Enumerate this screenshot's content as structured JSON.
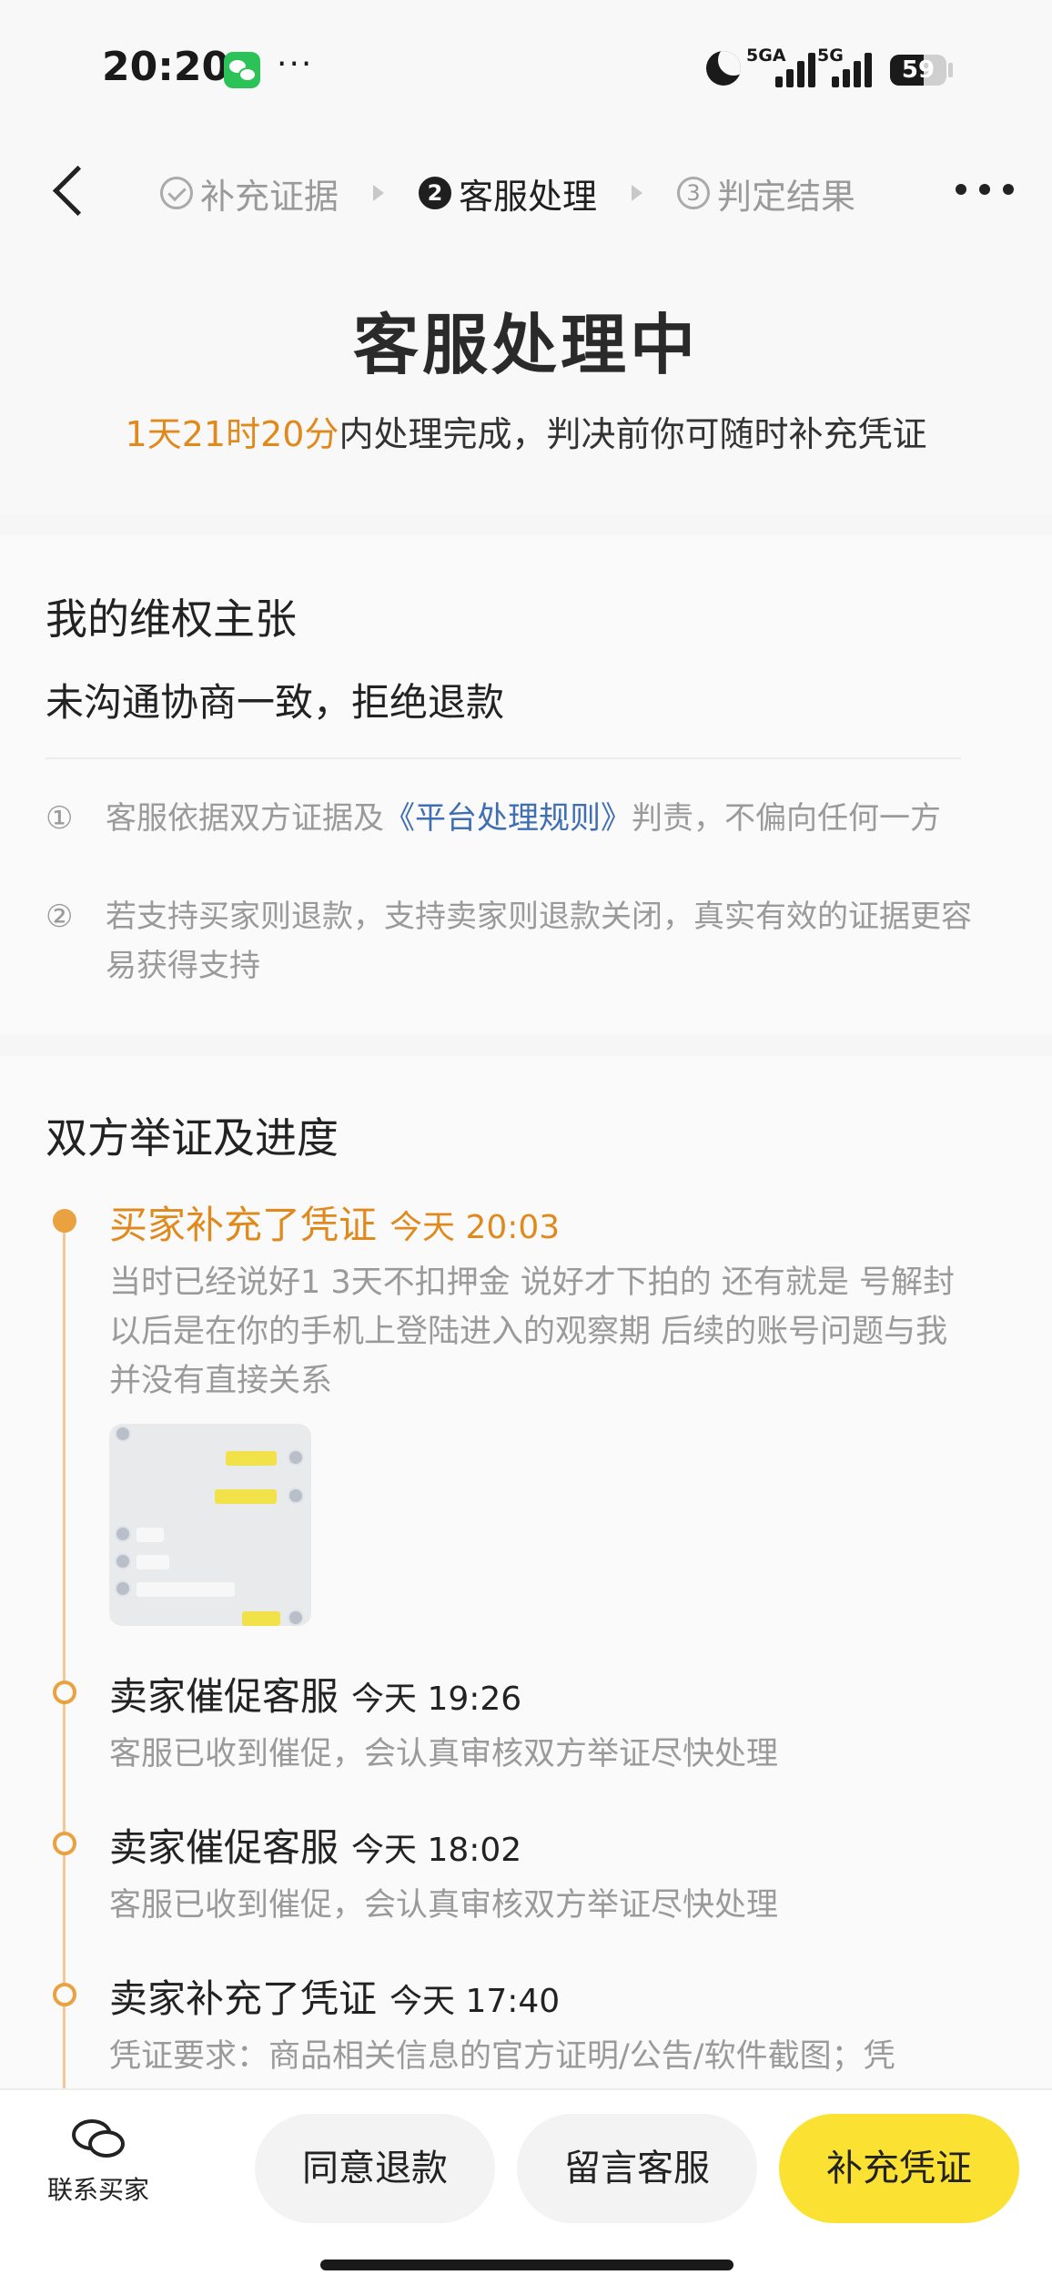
{
  "status_bar": {
    "time": "20:20",
    "app_icon": "wechat-icon",
    "more": "···",
    "net1": "5GA",
    "net2": "5G",
    "battery": "59",
    "battery_level": 0.59
  },
  "nav": {
    "steps": [
      {
        "label": "补充证据",
        "state": "done",
        "icon": "check-circle-icon"
      },
      {
        "label": "客服处理",
        "state": "active",
        "icon": "2"
      },
      {
        "label": "判定结果",
        "state": "pending",
        "icon": "3"
      }
    ]
  },
  "status": {
    "title": "客服处理中",
    "countdown": "1天21时20分",
    "subtitle_rest": "内处理完成，判决前你可随时补充凭证",
    "highlight_color": "#e08a1e"
  },
  "claim": {
    "title": "我的维权主张",
    "text": "未沟通协商一致，拒绝退款",
    "rules": [
      {
        "no": "①",
        "pre": "客服依据双方证据及",
        "link": "《平台处理规则》",
        "post": "判责，不偏向任何一方"
      },
      {
        "no": "②",
        "pre": "若支持买家则退款，支持卖家则退款关闭，真实有效的证据更容易获得支持",
        "link": "",
        "post": ""
      }
    ]
  },
  "progress": {
    "title": "双方举证及进度",
    "items": [
      {
        "title": "买家补充了凭证",
        "time": "今天 20:03",
        "desc": "当时已经说好1 3天不扣押金 说好才下拍的 还有就是 号解封以后是在你的手机上登陆进入的观察期 后续的账号问题与我并没有直接关系",
        "has_image": true
      },
      {
        "title": "卖家催促客服",
        "time": "今天 19:26",
        "desc": "客服已收到催促，会认真审核双方举证尽快处理"
      },
      {
        "title": "卖家催促客服",
        "time": "今天 18:02",
        "desc": "客服已收到催促，会认真审核双方举证尽快处理"
      },
      {
        "title": "卖家补充了凭证",
        "time": "今天 17:40",
        "desc": "凭证要求：商品相关信息的官方证明/公告/软件截图；凭"
      }
    ]
  },
  "bottom": {
    "contact_label": "联系买家",
    "agree_label": "同意退款",
    "message_label": "留言客服",
    "supplement_label": "补充凭证",
    "accent": "#fbe232"
  }
}
